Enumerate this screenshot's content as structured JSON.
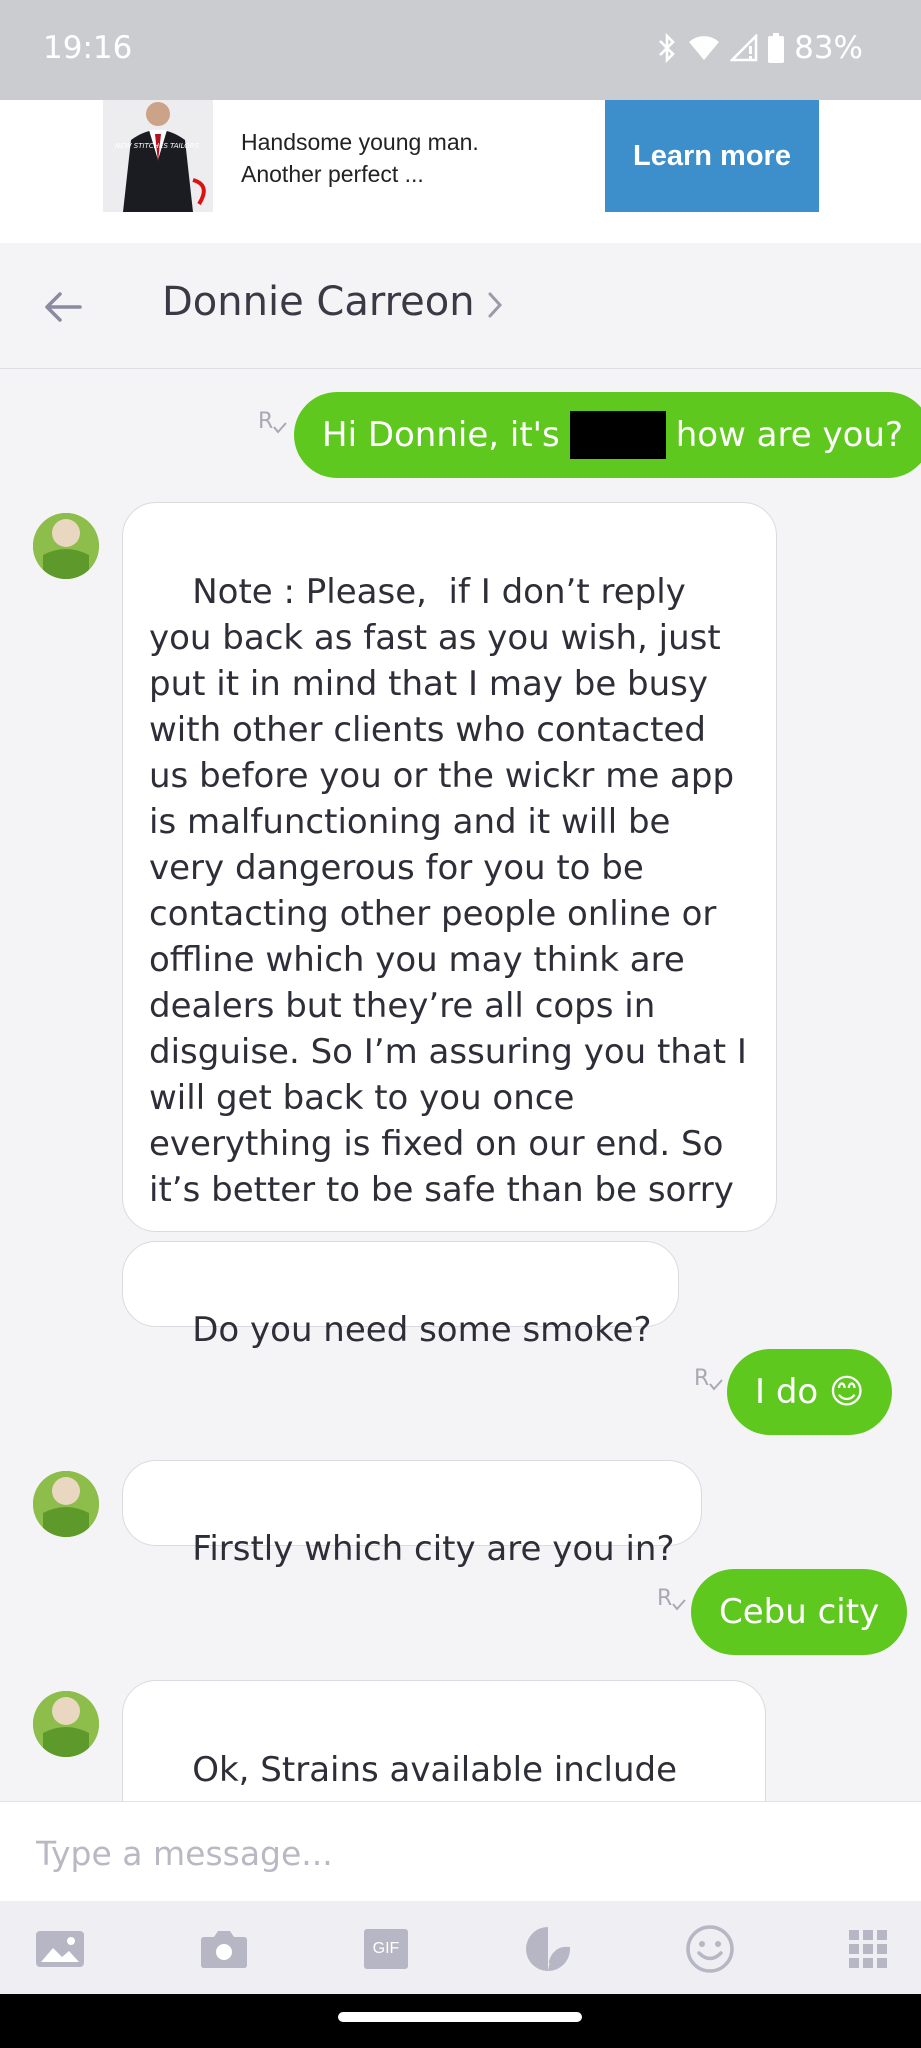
{
  "status": {
    "time": "19:16",
    "battery": "83%"
  },
  "ad": {
    "thumb_text": "NEW STITCHES TAILORS",
    "line1": "Handsome young man.",
    "line2": "Another perfect ...",
    "button": "Learn more"
  },
  "header": {
    "contact": "Donnie Carreon"
  },
  "messages": {
    "m1_pre": "Hi Donnie, it's",
    "m1_post": "how are you?",
    "m2": "Note : Please,  if I don’t reply you back as fast as you wish, just put it in mind that I may be busy with other clients who contacted us before you or the wickr me app is malfunctioning and it will be very dangerous for you to be contacting other people online or offline which you may think are dealers but they’re all cops in disguise. So I’m assuring you that I will get back to you once everything is fixed on our end. So it’s better to be safe than be sorry\n\nJust be patient.",
    "m3": "Do you need some smoke?",
    "m4": "I do 😊",
    "m5": "Firstly which city are you in?",
    "m6": "Cebu city",
    "m7": "Ok, Strains available include jack herer, amnesia haze,  purple kush,"
  },
  "receipt_glyph": "R",
  "composer": {
    "placeholder": "Type a message..."
  },
  "toolbar": {
    "gif_label": "GIF"
  },
  "colors": {
    "outgoing": "#5fc81e",
    "ad_button": "#3d8fcb",
    "status_bar": "#cbcccf"
  }
}
